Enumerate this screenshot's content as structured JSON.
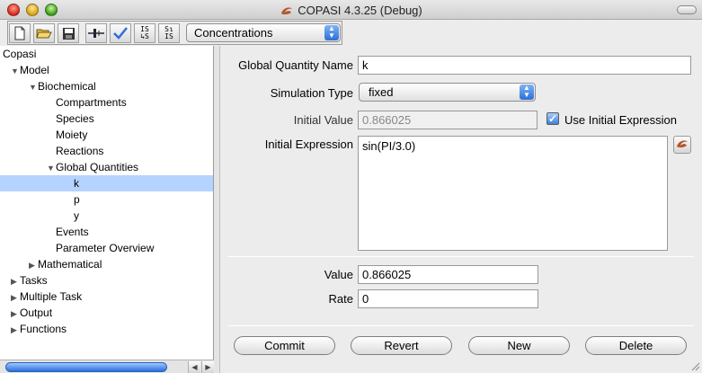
{
  "window": {
    "title": "COPASI 4.3.25 (Debug)"
  },
  "toolbar": {
    "buttons": [
      "new-file-icon",
      "open-folder-icon",
      "save-icon",
      "slider-icon",
      "check-icon",
      "is-to-s-icon",
      "s-to-is-icon"
    ],
    "is_s_top": "IS",
    "is_s_bottom": "S",
    "s_is_top": "S",
    "s_is_bottom": "IS",
    "combo_value": "Concentrations"
  },
  "tree": {
    "root": "Copasi",
    "model": "Model",
    "biochemical": "Biochemical",
    "compartments": "Compartments",
    "species": "Species",
    "moiety": "Moiety",
    "reactions": "Reactions",
    "global_quantities": "Global Quantities",
    "k": "k",
    "p": "p",
    "y": "y",
    "events": "Events",
    "parameter_overview": "Parameter Overview",
    "mathematical": "Mathematical",
    "tasks": "Tasks",
    "multiple_task": "Multiple Task",
    "output": "Output",
    "functions": "Functions"
  },
  "form": {
    "name_label": "Global Quantity Name",
    "name_value": "k",
    "sim_type_label": "Simulation Type",
    "sim_type_value": "fixed",
    "initial_value_label": "Initial Value",
    "initial_value": "0.866025",
    "use_initial_expression_label": "Use Initial Expression",
    "use_initial_expression_checked": true,
    "initial_expression_label": "Initial Expression",
    "initial_expression": "sin(PI/3.0)",
    "value_label": "Value",
    "value": "0.866025",
    "rate_label": "Rate",
    "rate": "0"
  },
  "buttons": {
    "commit": "Commit",
    "revert": "Revert",
    "new": "New",
    "delete": "Delete"
  },
  "colors": {
    "selection": "#b5d3ff",
    "accent": "#2d6fd7",
    "logo": "#b5562a"
  }
}
